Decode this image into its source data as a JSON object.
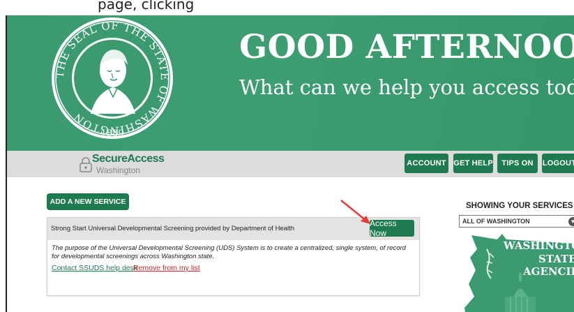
{
  "caption": {
    "text": "page, clicking"
  },
  "hero": {
    "greeting": "GOOD AFTERNOON!",
    "subtitle": "What can we help you access today?",
    "seal": {
      "top_text": "THE SEAL OF THE STATE OF WASHINGTON",
      "year": "1889"
    }
  },
  "brand": {
    "name": "SecureAccess",
    "sub": "Washington"
  },
  "nav": {
    "account": "ACCOUNT",
    "get_help": "GET HELP",
    "tips_on": "TIPS ON",
    "logout": "LOGOUT"
  },
  "add_service": "ADD A NEW SERVICE",
  "service_card": {
    "title": "Strong Start Universal Developmental Screening provided by Department of Health",
    "access_label": "Access Now",
    "description": "The purpose of the Universal Developmental Screening (UDS) System is to create a centralized, single system, of record for developmental screenings across Washington state.",
    "contact_link": "Contact SSUDS help desk",
    "remove_link": "Remove from my list"
  },
  "filter": {
    "label": "SHOWING YOUR SERVICES FROM",
    "selected": "ALL OF WASHINGTON",
    "map_line1": "WASHINGTON",
    "map_line2": "STATE",
    "map_line3": "AGENCIES"
  },
  "colors": {
    "brand_green": "#1e7a4f",
    "hero_green": "#3c9a70",
    "remove_red": "#c62828",
    "arrow_red": "#e53935"
  },
  "icons": {
    "lock": "lock-icon",
    "chevron": "chevron-down-icon",
    "arrow": "red-arrow-icon",
    "seal": "state-seal-icon",
    "map": "washington-map-icon"
  }
}
